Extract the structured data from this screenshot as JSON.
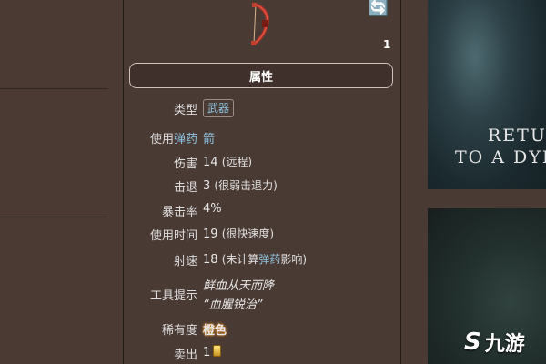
{
  "header": {
    "title": "属性"
  },
  "top": {
    "refresh_glyph": "🔄",
    "count": "1"
  },
  "properties": [
    {
      "key": "类型",
      "value": "武器"
    },
    {
      "key_a": "使用",
      "key_b": "弹药",
      "value": "箭"
    },
    {
      "key": "伤害",
      "value": "14",
      "note": "(远程)"
    },
    {
      "key": "击退",
      "value": "3",
      "note": "(很弱击退力)"
    },
    {
      "key": "暴击率",
      "value": "4%"
    },
    {
      "key": "使用时间",
      "value": "19",
      "note": "(很快速度)"
    },
    {
      "key": "射速",
      "value": "18",
      "note_a": "(未计算",
      "note_b": "弹药",
      "note_c": "影响)"
    },
    {
      "key": "工具提示",
      "line1": "鲜血从天而降",
      "line2": "“血腥锐治”"
    },
    {
      "key": "稀有度",
      "value": "橙色"
    },
    {
      "key": "卖出",
      "value": "1"
    }
  ],
  "right": {
    "poster_line1": "RETU",
    "poster_line2": "TO A DYI"
  },
  "watermark": {
    "mark": "S",
    "text": "九游"
  }
}
